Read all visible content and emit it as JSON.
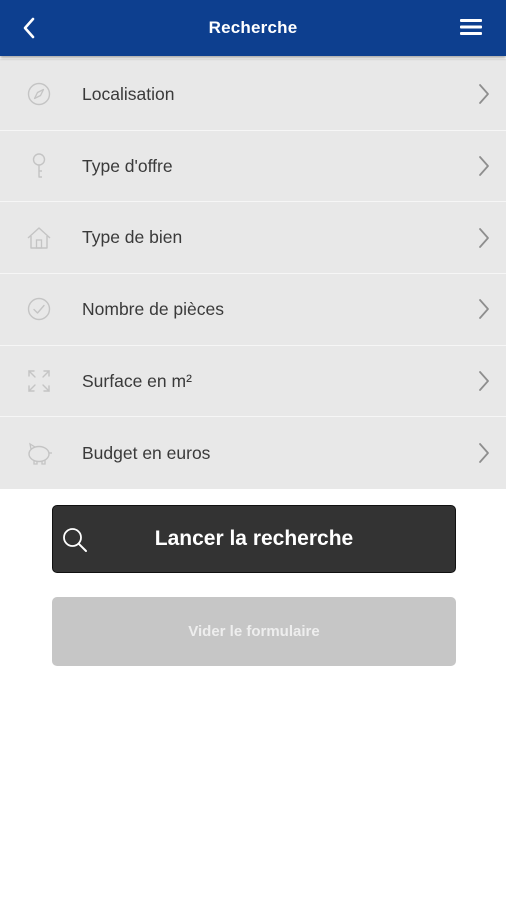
{
  "header": {
    "title": "Recherche",
    "back_icon": "chevron-left-icon",
    "menu_icon": "hamburger-menu-icon",
    "color": "#0d3f8f"
  },
  "criteria": [
    {
      "label": "Localisation",
      "icon": "compass-icon"
    },
    {
      "label": "Type d'offre",
      "icon": "key-icon"
    },
    {
      "label": "Type de bien",
      "icon": "house-icon"
    },
    {
      "label": "Nombre de pièces",
      "icon": "check-circle-icon"
    },
    {
      "label": "Surface en m²",
      "icon": "expand-arrows-icon"
    },
    {
      "label": "Budget en euros",
      "icon": "piggy-bank-icon"
    }
  ],
  "actions": {
    "search_label": "Lancer la recherche",
    "search_icon": "search-icon",
    "clear_label": "Vider le formulaire"
  }
}
